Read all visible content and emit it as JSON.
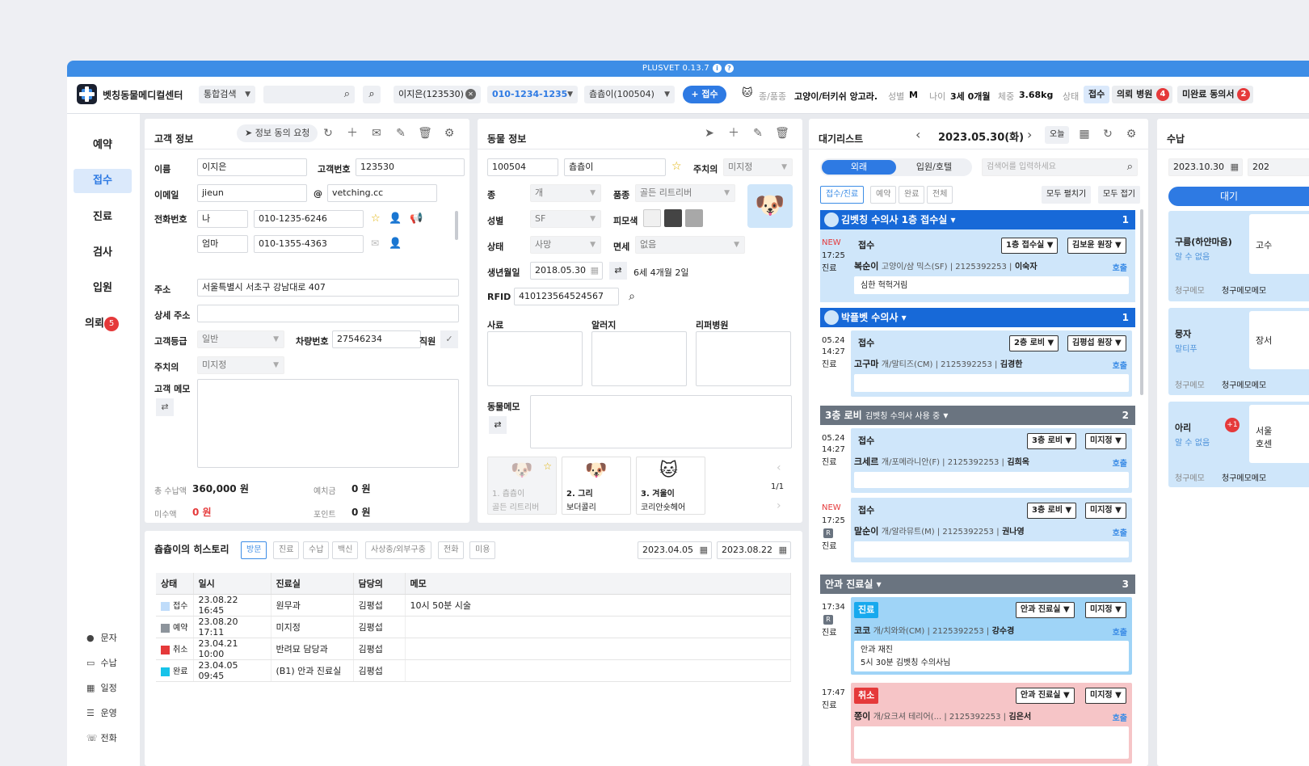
{
  "version_bar": {
    "label": "PLUSVET 0.13.7"
  },
  "header": {
    "clinic_name": "벳칭동물메디컬센터",
    "search_type": "통합검색",
    "client_tag": "이지은(123530)",
    "phone_tag": "010-1234-1235",
    "pet_tag": "츕츕이(100504)",
    "register_button": "+ 접수",
    "species_label": "종/품종",
    "species_value": "고양이/터키쉬 앙고라...",
    "sex_label": "성별",
    "sex_value": "M",
    "age_label": "나이",
    "age_value": "3세 0개월",
    "weight_label": "체중",
    "weight_value": "3.68kg",
    "status_label": "상태",
    "status_value": "접수",
    "referral_hospital_btn": "의뢰 병원",
    "referral_count": "4",
    "consent_btn": "미완료 동의서",
    "consent_count": "2"
  },
  "nav": {
    "items": [
      {
        "label": "예약"
      },
      {
        "label": "접수"
      },
      {
        "label": "진료"
      },
      {
        "label": "검사"
      },
      {
        "label": "입원"
      },
      {
        "label": "의뢰"
      }
    ],
    "referral_badge": "5",
    "sub": [
      {
        "icon": "message-icon",
        "label": "문자"
      },
      {
        "icon": "card-icon",
        "label": "수납"
      },
      {
        "icon": "calendar-icon",
        "label": "일정"
      },
      {
        "icon": "list-icon",
        "label": "운영"
      },
      {
        "icon": "phone-icon",
        "label": "전화"
      }
    ]
  },
  "customer": {
    "title": "고객 정보",
    "consent_request": "정보 동의 요청",
    "name_label": "이름",
    "name": "이지은",
    "cust_no_label": "고객번호",
    "cust_no": "123530",
    "email_label": "이메일",
    "email_id": "jieun",
    "email_at": "@",
    "email_domain": "vetching.cc",
    "phone_label": "전화번호",
    "phone1_rel": "나",
    "phone1": "010-1235-6246",
    "phone2_rel": "엄마",
    "phone2": "010-1355-4363",
    "addr_label": "주소",
    "addr": "서울특별시 서초구 강남대로 407",
    "addr2_label": "상세 주소",
    "addr2": "",
    "grade_label": "고객등급",
    "grade": "일반",
    "car_label": "차량번호",
    "car": "27546234",
    "staff_label": "직원",
    "doctor_label": "주치의",
    "doctor": "미지정",
    "memo_label": "고객 메모",
    "total_paid_label": "총 수납액",
    "total_paid": "360,000 원",
    "deposit_label": "예치금",
    "deposit": "0 원",
    "unpaid_label": "미수액",
    "unpaid": "0 원",
    "points_label": "포인트",
    "points": "0 원"
  },
  "animal": {
    "title": "동물 정보",
    "id": "100504",
    "name": "츕츕이",
    "doctor_label": "주치의",
    "doctor": "미지정",
    "species_label": "종",
    "species": "개",
    "breed_label": "품종",
    "breed": "골든 리트리버",
    "sex_label": "성별",
    "sex": "SF",
    "coat_label": "피모색",
    "status_label": "상태",
    "status": "사망",
    "tax_label": "면세",
    "tax": "없음",
    "birth_label": "생년월일",
    "birth": "2018.05.30",
    "age": "6세 4개월 2일",
    "rfid_label": "RFID",
    "rfid": "410123564524567",
    "reason_label": "사료",
    "allergy_label": "알러지",
    "referrer_label": "리퍼병원",
    "memo_label": "동물메모",
    "pets": [
      {
        "label": "1. 츕츕이",
        "breed": "골든 리트리버"
      },
      {
        "label": "2. 그리",
        "breed": "보더콜리"
      },
      {
        "label": "3. 겨울이",
        "breed": "코리안숏헤어"
      }
    ],
    "pager": "1/1",
    "coat_colors": [
      "#f0f0f0",
      "#444444",
      "#a8a8a8"
    ]
  },
  "history": {
    "title": "츕츕이의 히스토리",
    "tabs": [
      "방문",
      "진료",
      "수납",
      "백신",
      "사상충/외부구충",
      "전화",
      "미용"
    ],
    "date_from": "2023.04.05",
    "date_to": "2023.08.22",
    "columns": [
      "상태",
      "일시",
      "진료실",
      "담당의",
      "메모"
    ],
    "rows": [
      {
        "status": "접수",
        "color": "#bfdcfa",
        "time": "23.08.22 16:45",
        "room": "원무과",
        "doctor": "김평섭",
        "memo": "10시 50분 시술"
      },
      {
        "status": "예약",
        "color": "#8d949c",
        "time": "23.08.20 17:11",
        "room": "미지정",
        "doctor": "김평섭",
        "memo": ""
      },
      {
        "status": "취소",
        "color": "#e5393a",
        "time": "23.04.21 10:00",
        "room": "반려묘 담당과",
        "doctor": "김평섭",
        "memo": ""
      },
      {
        "status": "완료",
        "color": "#17c3e9",
        "time": "23.04.05 09:45",
        "room": "(B1) 안과 진료실",
        "doctor": "김평섭",
        "memo": ""
      }
    ]
  },
  "waitlist": {
    "title": "대기리스트",
    "date": "2023.05.30(화)",
    "today": "오늘",
    "tabs": [
      "외래",
      "입원/호텔"
    ],
    "search_placeholder": "검색어를 입력하세요",
    "filters": [
      "접수/진료",
      "예약",
      "완료",
      "전체"
    ],
    "expand_all": "모두 펼치기",
    "collapse_all": "모두 접기",
    "groups": [
      {
        "title": "김벳칭 수의사 1층 접수실",
        "count": "1"
      },
      {
        "title": "박플벳 수의사",
        "count": "1"
      },
      {
        "title": "3층 로비",
        "sub": "김벳칭 수의사 사용 중",
        "count": "2"
      },
      {
        "title": "안과 진료실",
        "count": "3"
      }
    ],
    "entries": [
      {
        "time1": "NEW",
        "time2": "17:25",
        "state": "진료",
        "chip": "접수",
        "room": "1층 접수실",
        "doc": "김보윤 원장",
        "pet": "복순이",
        "info": "고양이/샴 믹스(SF) | 2125392253 |",
        "owner": "이숙자",
        "call": "호출",
        "memo": "심한 헉헉거림"
      },
      {
        "time1": "05.24",
        "time2": "14:27",
        "state": "진료",
        "chip": "접수",
        "room": "2층 로비",
        "doc": "김평섭 원장",
        "pet": "고구마",
        "info": "개/말티즈(CM) | 2125392253 |",
        "owner": "김경한",
        "call": "호출"
      },
      {
        "time1": "05.24",
        "time2": "14:27",
        "state": "진료",
        "chip": "접수",
        "room": "3층 로비",
        "doc": "미지정",
        "pet": "크세르",
        "info": "개/포메라니안(F) | 2125392253 |",
        "owner": "김희옥",
        "call": "호출"
      },
      {
        "time1": "NEW",
        "time2": "17:25",
        "state": "진료",
        "chip": "접수",
        "room": "3층 로비",
        "doc": "미지정",
        "pet": "말순이",
        "info": "개/알라뮤트(M) | 2125392253 |",
        "owner": "권나영",
        "call": "호출"
      },
      {
        "time1": "17:34",
        "state": "진료",
        "chip": "진료",
        "room": "안과 진료실",
        "doc": "미지정",
        "pet": "코코",
        "info": "개/치와와(CM) | 2125392253 |",
        "owner": "강수경",
        "call": "호출",
        "memo1": "안과 재진",
        "memo2": "5시 30분 김벳칭 수의사님"
      },
      {
        "time1": "17:47",
        "state": "진료",
        "chip": "취소",
        "room": "안과 진료실",
        "doc": "미지정",
        "pet": "쫑이",
        "info": "개/요크셔 테리어(... | 2125392253 |",
        "owner": "김은서",
        "call": "호출"
      }
    ]
  },
  "payment": {
    "title": "수납",
    "date": "2023.10.30",
    "date2": "202",
    "tab": "대기",
    "cards": [
      {
        "name": "구름(하얀마음)",
        "sub": "알 수 없음",
        "side": "고수",
        "m1": "청구메모",
        "m2": "청구메모메모"
      },
      {
        "name": "뭉자",
        "sub": "말티푸",
        "side": "장서",
        "m1": "청구메모",
        "m2": "청구메모메모"
      },
      {
        "name": "아리",
        "sub": "알 수 없음",
        "side": "서울",
        "side2": "호센",
        "badge": "+1",
        "m1": "청구메모",
        "m2": "청구메모메모"
      }
    ]
  }
}
